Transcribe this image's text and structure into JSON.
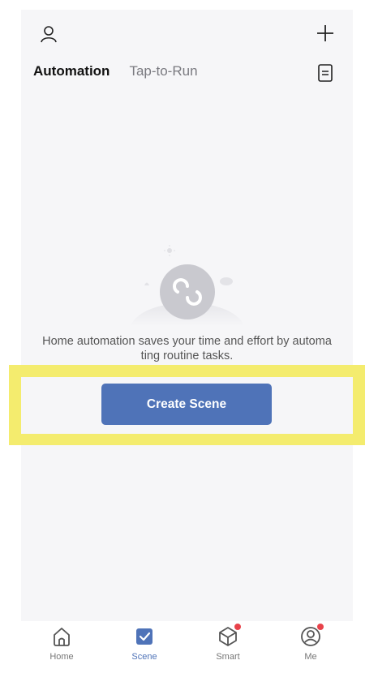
{
  "header": {
    "profile_icon": "profile-icon",
    "add_icon": "plus-icon",
    "log_icon": "log-list-icon"
  },
  "tabs": [
    {
      "label": "Automation",
      "active": true
    },
    {
      "label": "Tap-to-Run",
      "active": false
    }
  ],
  "empty_state": {
    "illustration_icon": "sync-loop-icon",
    "message": "Home automation saves your time and effort by automa ting routine tasks.",
    "button_label": "Create Scene"
  },
  "colors": {
    "accent": "#4f73b8",
    "highlight": "#f4ec6e",
    "badge": "#e8424a"
  },
  "bottom_nav": [
    {
      "label": "Home",
      "icon": "home-icon",
      "active": false,
      "badge": false
    },
    {
      "label": "Scene",
      "icon": "scene-check-icon",
      "active": true,
      "badge": false
    },
    {
      "label": "Smart",
      "icon": "smart-cube-icon",
      "active": false,
      "badge": true
    },
    {
      "label": "Me",
      "icon": "me-profile-icon",
      "active": false,
      "badge": true
    }
  ]
}
